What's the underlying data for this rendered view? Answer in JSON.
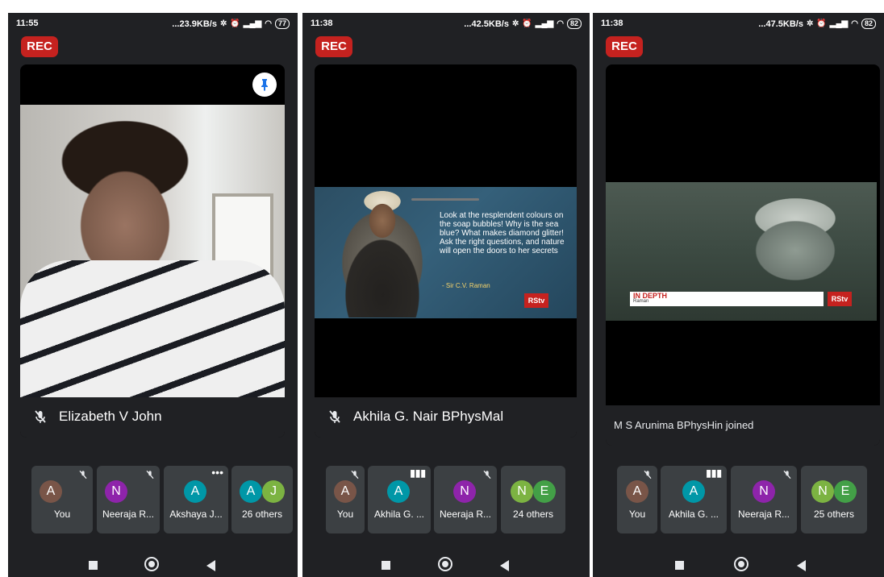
{
  "colors": {
    "background": "#202124",
    "rec": "#c5221f",
    "tile": "#3c4043"
  },
  "panels": [
    {
      "status": {
        "time": "11:55",
        "speed": "...23.9KB/s",
        "battery": "77"
      },
      "rec_label": "REC",
      "speaker_name": "Elizabeth V John",
      "tiles": [
        {
          "avatar": "A",
          "label": "You",
          "color": "#795548"
        },
        {
          "avatar": "N",
          "label": "Neeraja R...",
          "color": "#8e24aa"
        },
        {
          "avatar": "A",
          "label": "Akshaya J...",
          "color": "#0097a7"
        },
        {
          "avatar_a": "A",
          "avatar_b": "J",
          "label": "26 others",
          "color_a": "#0097a7",
          "color_b": "#7cb342"
        }
      ]
    },
    {
      "status": {
        "time": "11:38",
        "speed": "...42.5KB/s",
        "battery": "82"
      },
      "rec_label": "REC",
      "speaker_name": "Akhila G. Nair BPhysMal",
      "slide": {
        "quote": "Look at the resplendent colours on the soap bubbles! Why is the sea blue? What makes diamond glitter! Ask the right questions, and nature will open the doors to her secrets",
        "author": "- Sir C.V. Raman",
        "channel": "RStv"
      },
      "tiles": [
        {
          "avatar": "A",
          "label": "You",
          "color": "#795548"
        },
        {
          "avatar": "A",
          "label": "Akhila G. ...",
          "color": "#0097a7"
        },
        {
          "avatar": "N",
          "label": "Neeraja R...",
          "color": "#8e24aa"
        },
        {
          "avatar_a": "N",
          "avatar_b": "E",
          "label": "24 others",
          "color_a": "#7cb342",
          "color_b": "#43a047"
        }
      ]
    },
    {
      "status": {
        "time": "11:38",
        "speed": "...47.5KB/s",
        "battery": "82"
      },
      "rec_label": "REC",
      "video": {
        "lower_third": "IN DEPTH",
        "sub": "Raman",
        "channel": "RStv"
      },
      "notification": "M S Arunima BPhysHin joined",
      "tiles": [
        {
          "avatar": "A",
          "label": "You",
          "color": "#795548"
        },
        {
          "avatar": "A",
          "label": "Akhila G. ...",
          "color": "#0097a7"
        },
        {
          "avatar": "N",
          "label": "Neeraja R...",
          "color": "#8e24aa"
        },
        {
          "avatar_a": "N",
          "avatar_b": "E",
          "label": "25 others",
          "color_a": "#7cb342",
          "color_b": "#43a047"
        }
      ]
    }
  ]
}
